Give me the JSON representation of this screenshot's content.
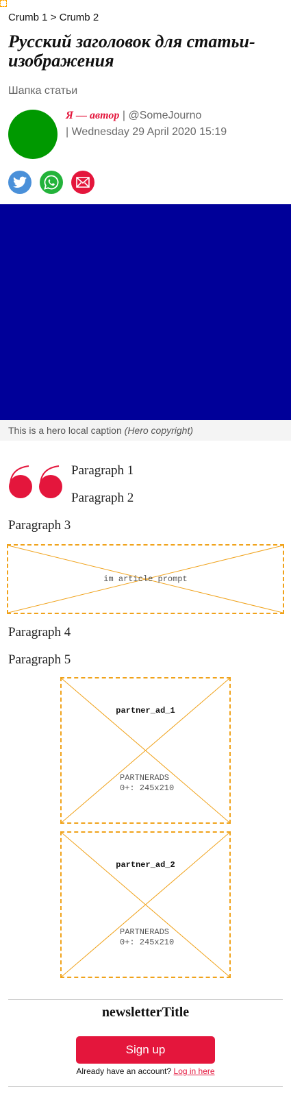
{
  "breadcrumb": {
    "crumb1": "Crumb 1",
    "separator": " > ",
    "crumb2": "Crumb 2"
  },
  "article": {
    "title": "Русский заголовок для статьи-изображения",
    "standfirst": "Шапка статьи",
    "author": "Я — автор",
    "author_separator": " | ",
    "handle": "@SomeJourno",
    "date_prefix": "| ",
    "date": "Wednesday 29 April 2020 15:19"
  },
  "share": {
    "icons": [
      "twitter-icon",
      "whatsapp-icon",
      "email-icon"
    ]
  },
  "hero": {
    "color": "#000099",
    "caption": "This is a hero local caption",
    "copyright": "(Hero copyright)"
  },
  "body": {
    "paragraphs": [
      "Paragraph 1",
      "Paragraph 2",
      "Paragraph 3",
      "Paragraph 4",
      "Paragraph 5"
    ],
    "in_article_prompt": "im article prompt"
  },
  "ads": [
    {
      "name": "partner_ad_1",
      "label1": "PARTNERADS",
      "label2": "0+: 245x210"
    },
    {
      "name": "partner_ad_2",
      "label1": "PARTNERADS",
      "label2": "0+: 245x210"
    }
  ],
  "newsletter": {
    "title": "newsletterTitle",
    "signup_label": "Sign up",
    "account_text": "Already have an account? ",
    "login_link": "Log in here"
  },
  "colors": {
    "accent": "#e4163c",
    "avatar": "#009900",
    "placeholder_border": "#f0a21a"
  }
}
